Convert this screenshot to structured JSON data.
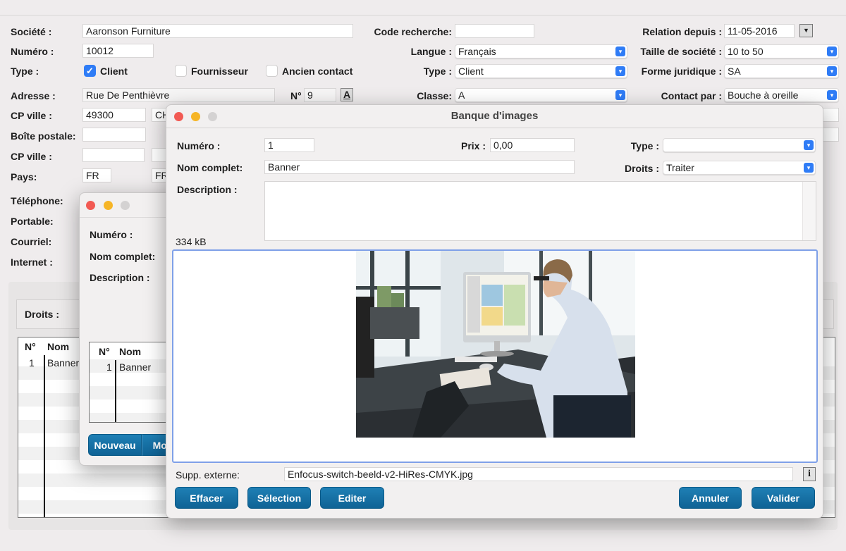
{
  "main": {
    "societe_label": "Société :",
    "societe": "Aaronson Furniture",
    "numero_label": "Numéro :",
    "numero": "10012",
    "type_label": "Type :",
    "checkboxes": [
      {
        "label": "Client",
        "checked": true
      },
      {
        "label": "Fournisseur",
        "checked": false
      },
      {
        "label": "Ancien contact",
        "checked": false
      }
    ],
    "adresse_label": "Adresse :",
    "adresse": "Rue De Penthièvre",
    "no_label": "N°",
    "no": "9",
    "font_button": "A",
    "cp_ville_label": "CP ville :",
    "cp": "49300",
    "ville": "CH",
    "boite_label": "Boîte postale:",
    "cp_ville2_label": "CP ville :",
    "pays_label": "Pays:",
    "pays": "FR",
    "pays_name": "FR",
    "telephone_label": "Téléphone:",
    "portable_label": "Portable:",
    "courriel_label": "Courriel:",
    "internet_label": "Internet :",
    "code_label": "Code recherche:",
    "code": "",
    "langue_label": "Langue :",
    "langue": "Français",
    "type2_label": "Type :",
    "type2": "Client",
    "classe_label": "Classe:",
    "classe": "A",
    "relation_label": "Relation depuis :",
    "relation": "11-05-2016",
    "taille_label": "Taille de société :",
    "taille": "10 to 50",
    "forme_label": "Forme juridique :",
    "forme": "SA",
    "contact_label": "Contact par :",
    "contact": "Bouche à oreille",
    "droits_label": "Droits :",
    "table": {
      "headers": [
        "N°",
        "Nom"
      ],
      "rows": [
        [
          "1",
          "Banner"
        ]
      ]
    }
  },
  "mid_dialog": {
    "numero_label": "Numéro :",
    "nom_label": "Nom complet:",
    "desc_label": "Description :",
    "table": {
      "headers": [
        "N°",
        "Nom"
      ],
      "rows": [
        [
          "1",
          "Banner"
        ]
      ]
    },
    "buttons": [
      "Nouveau",
      "Mod"
    ]
  },
  "dialog": {
    "title": "Banque d'images",
    "numero_label": "Numéro :",
    "numero": "1",
    "prix_label": "Prix :",
    "prix": "0,00",
    "type_label": "Type :",
    "type": "",
    "nom_label": "Nom complet:",
    "nom": "Banner",
    "droits_label": "Droits :",
    "droits": "Traiter",
    "desc_label": "Description :",
    "description": "",
    "size": "334 kB",
    "supp_label": "Supp. externe:",
    "supp": "Enfocus-switch-beeld-v2-HiRes-CMYK.jpg",
    "info_button": "i",
    "buttons": {
      "effacer": "Effacer",
      "selection": "Sélection",
      "editer": "Editer",
      "annuler": "Annuler",
      "valider": "Valider"
    }
  },
  "colors": {
    "accent": "#2f7cf6",
    "button": "#1670a5",
    "image_border": "#7fa0e8"
  }
}
